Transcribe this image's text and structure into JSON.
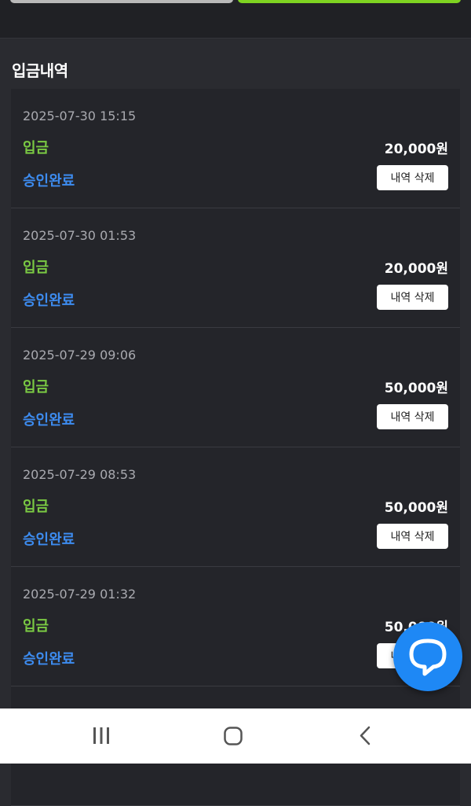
{
  "section_title": "입금내역",
  "transactions": [
    {
      "datetime": "2025-07-30 15:15",
      "type": "입금",
      "amount": "20,000원",
      "status": "승인완료",
      "delete_label": "내역 삭제"
    },
    {
      "datetime": "2025-07-30 01:53",
      "type": "입금",
      "amount": "20,000원",
      "status": "승인완료",
      "delete_label": "내역 삭제"
    },
    {
      "datetime": "2025-07-29 09:06",
      "type": "입금",
      "amount": "50,000원",
      "status": "승인완료",
      "delete_label": "내역 삭제"
    },
    {
      "datetime": "2025-07-29 08:53",
      "type": "입금",
      "amount": "50,000원",
      "status": "승인완료",
      "delete_label": "내역 삭제"
    },
    {
      "datetime": "2025-07-29 01:32",
      "type": "입금",
      "amount": "50,000원",
      "status": "승인완료",
      "delete_label": "내역 삭제"
    }
  ],
  "icons": {
    "chat": "chat-bubble-icon",
    "recent_apps": "recent-apps-icon",
    "home": "home-icon",
    "back": "back-icon"
  },
  "colors": {
    "deposit_type": "#7ac943",
    "status_approved": "#3d8cf0",
    "chat_button": "#1e88f5",
    "top_green_button": "#7ed321"
  }
}
